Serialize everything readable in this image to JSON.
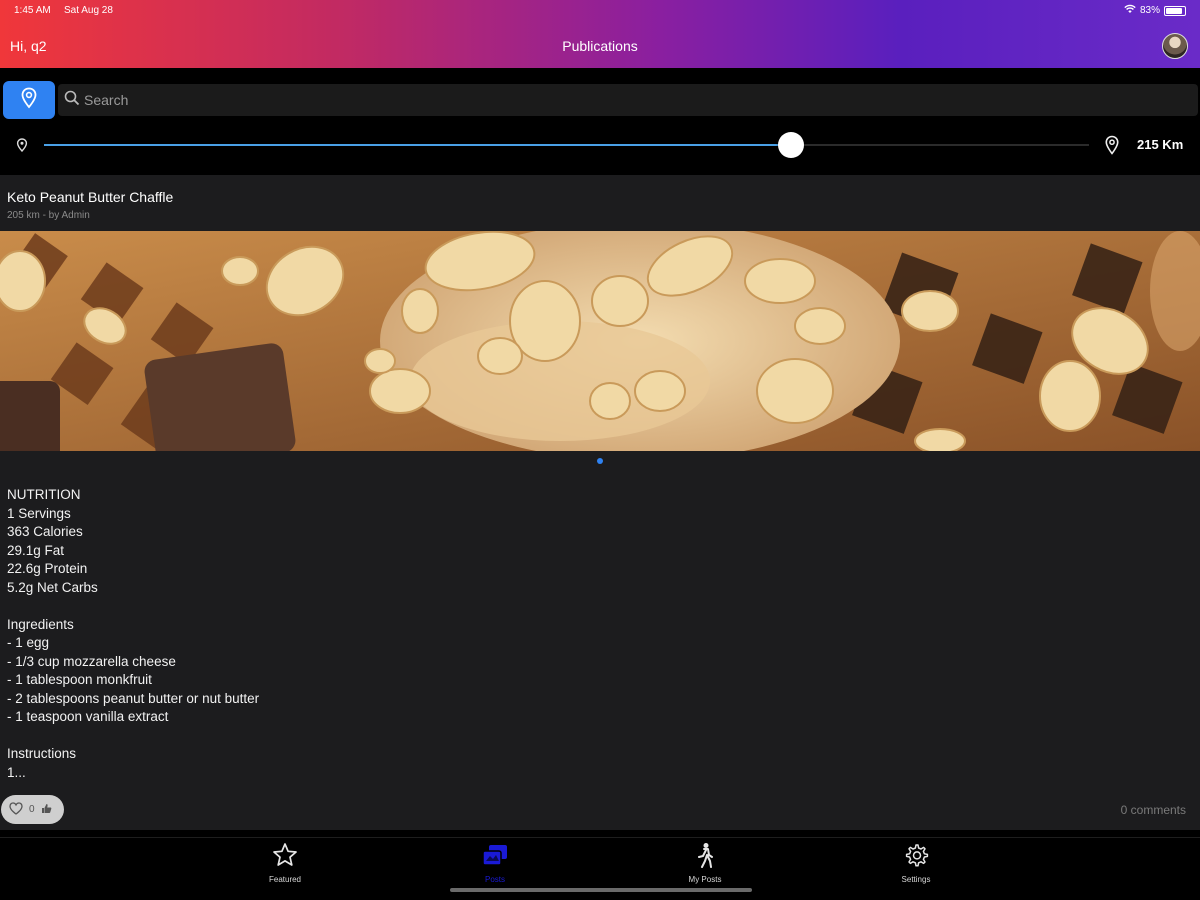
{
  "status_bar": {
    "time": "1:45 AM",
    "date": "Sat Aug 28",
    "battery": "83%"
  },
  "header": {
    "greeting": "Hi, q2",
    "title": "Publications"
  },
  "search": {
    "placeholder": "Search"
  },
  "distance_filter": {
    "value_label": "215 Km",
    "fraction": 0.715
  },
  "post": {
    "title": "Keto Peanut Butter Chaffle",
    "meta": "205 km - by Admin",
    "body": {
      "nutrition_heading": "NUTRITION",
      "nutrition": [
        "1 Servings",
        "363 Calories",
        "29.1g Fat",
        "22.6g Protein",
        "5.2g Net Carbs"
      ],
      "ingredients_heading": "Ingredients",
      "ingredients": [
        "- 1 egg",
        "- 1/3 cup mozzarella cheese",
        "- 1 tablespoon monkfruit",
        "- 2 tablespoons peanut butter or nut butter",
        "- 1 teaspoon vanilla extract"
      ],
      "instructions_heading": "Instructions",
      "instructions_preview": "1..."
    },
    "likes": "0",
    "comments": "0 comments"
  },
  "tabs": [
    {
      "label": "Featured",
      "icon": "star-icon",
      "active": false
    },
    {
      "label": "Posts",
      "icon": "posts-icon",
      "active": true
    },
    {
      "label": "My Posts",
      "icon": "walking-person-icon",
      "active": false
    },
    {
      "label": "Settings",
      "icon": "gear-icon",
      "active": false
    }
  ],
  "colors": {
    "accent": "#2f82f2",
    "slider_fill": "#4aa0e6",
    "active_tab": "#1a1ad6",
    "card_bg": "#1c1c1e"
  }
}
